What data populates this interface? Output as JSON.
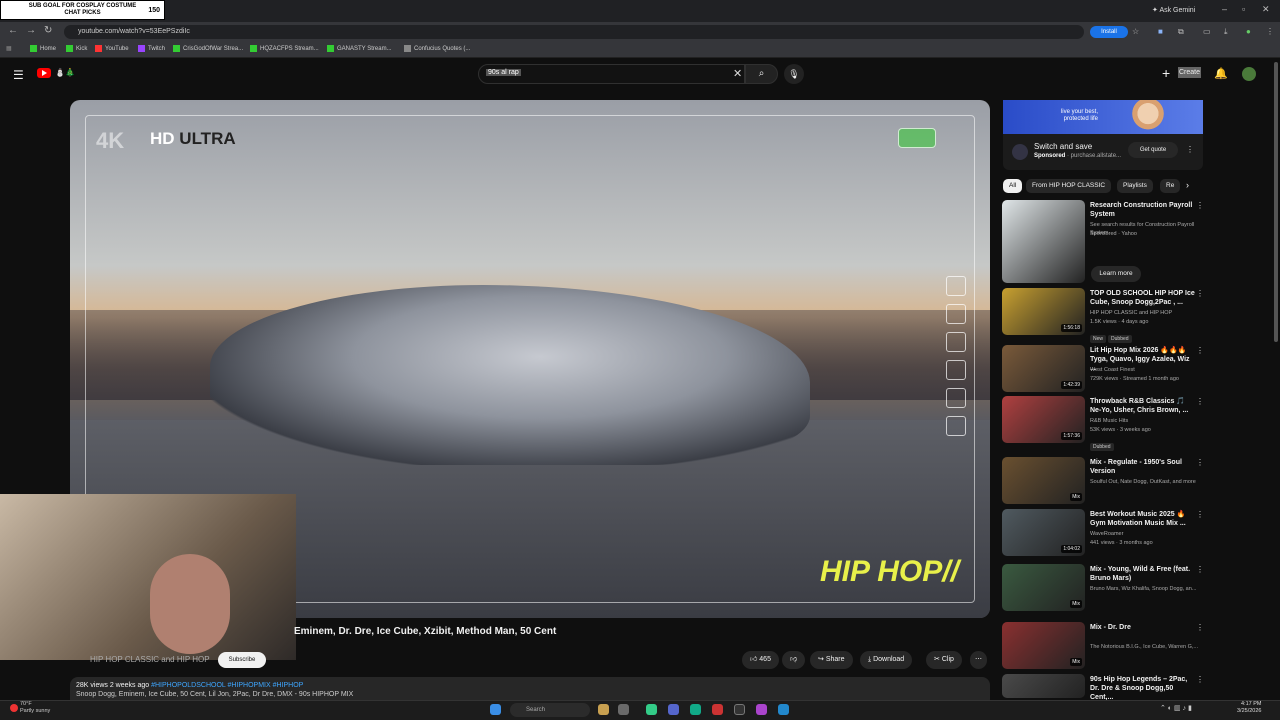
{
  "overlay": {
    "goal_text": "SUB GOAL FOR COSPLAY COSTUME\nCHAT PICKS",
    "goal_count": "150"
  },
  "browser": {
    "ask_gemini": "Ask Gemini",
    "url": "youtube.com/watch?v=53EePSzdiIc",
    "install": "Install",
    "bookmarks": [
      "Home",
      "Kick",
      "YouTube",
      "Twitch",
      "CrisGodOfWar Strea...",
      "HQZACFPS Stream...",
      "GANASTY Stream...",
      "Confucius Quotes (..."
    ]
  },
  "yt": {
    "search_value": "90s al rap",
    "create_label": "Create"
  },
  "video": {
    "badge_4k": "4K",
    "hd_prefix": "HD",
    "hd_suffix": " ULTRA",
    "overlay_brand": "HIP HOP//",
    "title": "Eminem, Dr. Dre, Ice Cube, Xzibit, Method Man, 50 Cent",
    "channel": "HIP HOP CLASSIC and HIP HOP",
    "subscribe": "Subscribe",
    "likes": "465",
    "share": "Share",
    "download": "Download",
    "clip": "Clip",
    "views_date": "28K views  2 weeks ago",
    "tags": "#HIPHOPOLDSCHOOL #HIPHOPMIX #HIPHOP",
    "desc_line": "Snoop Dogg, Eminem, Ice Cube, 50 Cent, Lil Jon, 2Pac, Dr Dre, DMX - 90s HIPHOP MIX"
  },
  "ad": {
    "banner": "live your best,\nprotected life",
    "title": "Switch and save",
    "sponsored": "Sponsored",
    "advertiser": " · purchase.allstate...",
    "cta": "Get quote"
  },
  "chips": [
    "All",
    "From HIP HOP CLASSIC",
    "Playlists",
    "Re"
  ],
  "related": [
    {
      "title": "Research Construction Payroll System",
      "sub1": "See search results for Construction Payroll System",
      "sub2": "Sponsored · Yahoo",
      "dur": "",
      "cta": "Learn more",
      "color": "#e0e6e8"
    },
    {
      "title": "TOP OLD SCHOOL HIP HOP Ice Cube, Snoop Dogg,2Pac , ...",
      "sub1": "HIP HOP CLASSIC and HIP HOP",
      "sub2": "1.5K views · 4 days ago",
      "badges": [
        "New",
        "Dubbed"
      ],
      "dur": "1:56:18",
      "color": "#c8a030"
    },
    {
      "title": "Lit Hip Hop Mix 2026 🔥🔥🔥 Tyga, Quavo, Iggy Azalea, Wiz ...",
      "sub1": "West Coast Finest",
      "sub2": "729K views · Streamed 1 month ago",
      "dur": "1:42:39",
      "color": "#7a5a3a"
    },
    {
      "title": "Throwback R&B Classics 🎵 Ne-Yo, Usher, Chris Brown, ...",
      "sub1": "R&B Music Hits",
      "sub2": "53K views · 3 weeks ago",
      "badges": [
        "Dubbed"
      ],
      "dur": "1:57:36",
      "color": "#b04040"
    },
    {
      "title": "Mix - Regulate - 1950's Soul Version",
      "sub1": "Soulful Out, Nate Dogg, OutKast, and more",
      "sub2": "",
      "dur": "Mix",
      "color": "#6a5030"
    },
    {
      "title": "Best Workout Music 2025 🔥 Gym Motivation Music Mix ...",
      "sub1": "WaveRoamer",
      "sub2": "441 views · 3 months ago",
      "dur": "1:04:02",
      "color": "#505a60"
    },
    {
      "title": "Mix - Young, Wild & Free (feat. Bruno Mars)",
      "sub1": "Bruno Mars, Wiz Khalifa, Snoop Dogg, an...",
      "sub2": "",
      "dur": "Mix",
      "color": "#3a5a40"
    },
    {
      "title": "Mix - Dr. Dre",
      "sub1": "The Notorious B.I.G., Ice Cube, Warren G,...",
      "sub2": "",
      "dur": "Mix",
      "color": "#8a3030"
    },
    {
      "title": "90s Hip Hop Legends – 2Pac, Dr. Dre & Snoop Dogg,50 Cent,...",
      "sub1": "",
      "sub2": "",
      "dur": "",
      "color": "#4a4a4a"
    }
  ],
  "taskbar": {
    "weather_temp": "70°F",
    "weather_desc": "Partly sunny",
    "search": "Search",
    "time": "4:17 PM",
    "date": "3/25/2026"
  }
}
